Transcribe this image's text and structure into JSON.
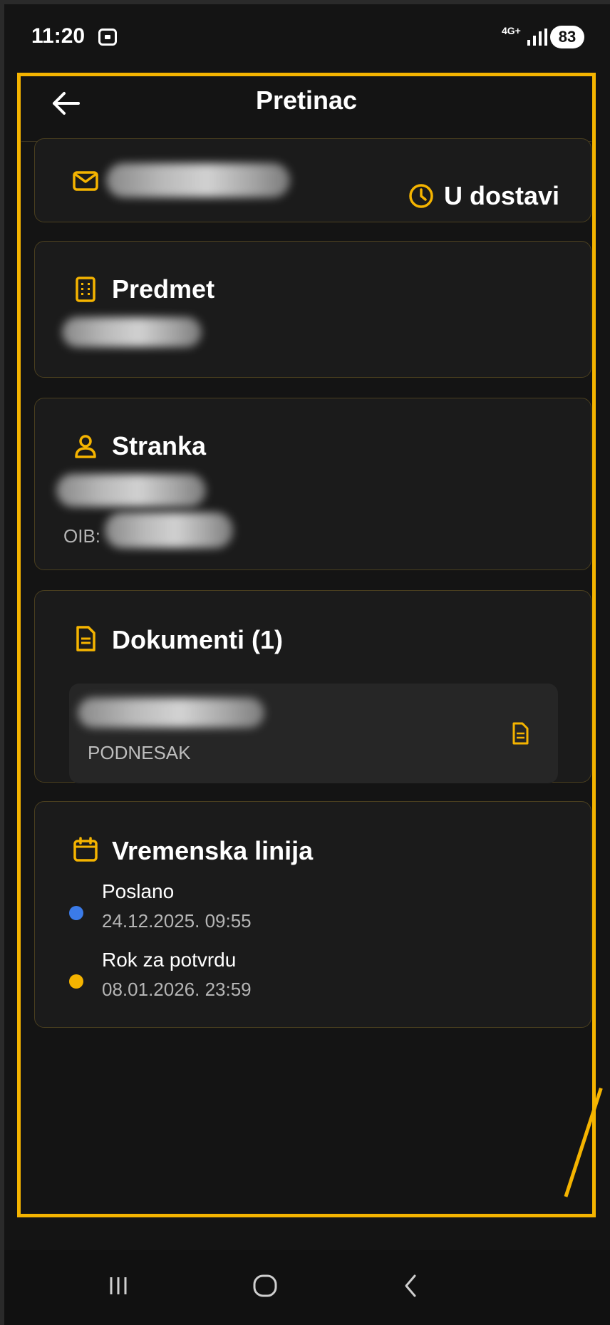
{
  "status_bar": {
    "time": "11:20",
    "network": "4G+",
    "battery": "83"
  },
  "header": {
    "title": "Pretinac"
  },
  "message": {
    "status": "U dostavi"
  },
  "subject": {
    "title": "Predmet"
  },
  "party": {
    "title": "Stranka",
    "oib_label": "OIB:"
  },
  "documents": {
    "title": "Dokumenti (1)",
    "items": [
      {
        "type": "PODNESAK"
      }
    ]
  },
  "timeline": {
    "title": "Vremenska linija",
    "events": [
      {
        "label": "Poslano",
        "date": "24.12.2025. 09:55",
        "color": "#3b7be8"
      },
      {
        "label": "Rok za potvrdu",
        "date": "08.01.2026. 23:59",
        "color": "#f5b400"
      }
    ]
  },
  "colors": {
    "accent": "#f5b400",
    "background": "#141414",
    "card": "#1b1b1b"
  }
}
